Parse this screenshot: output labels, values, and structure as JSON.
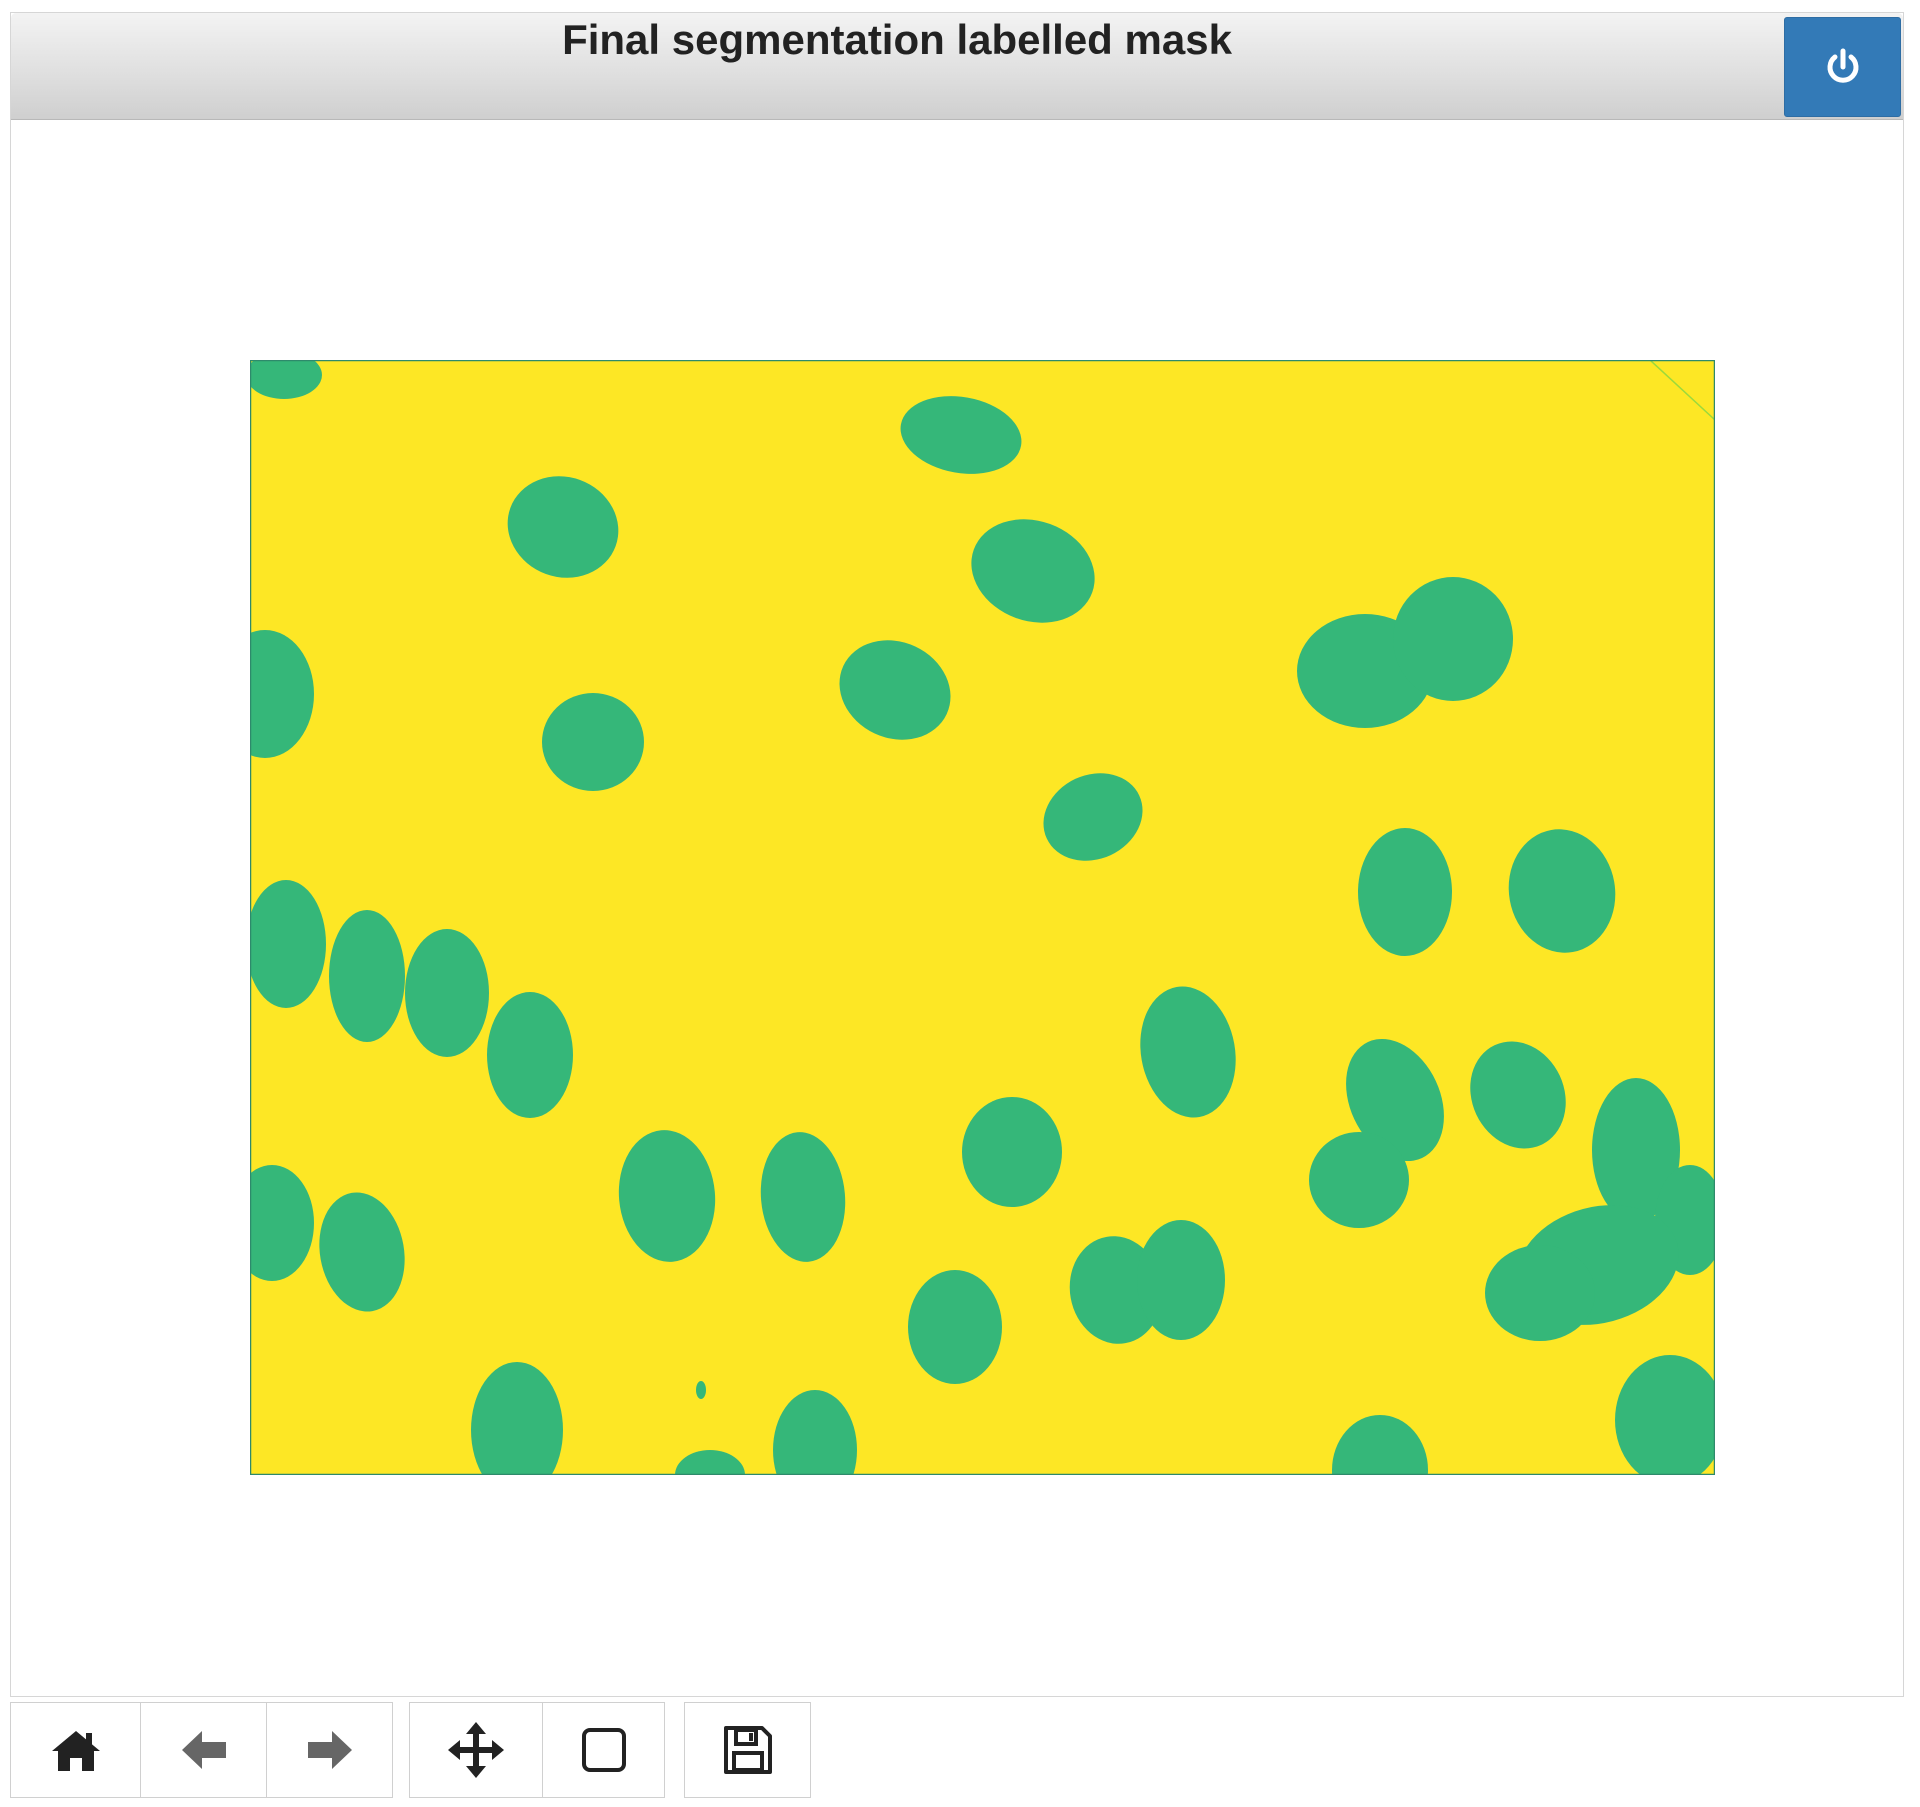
{
  "window": {
    "title": "Final segmentation labelled mask"
  },
  "image": {
    "background_color": "#FDE725",
    "object_color": "#35B779",
    "border_color": "#2E8A6B"
  },
  "toolbar": {
    "buttons": [
      {
        "icon": "home-icon"
      },
      {
        "icon": "arrow-left-icon"
      },
      {
        "icon": "arrow-right-icon"
      },
      {
        "icon": "move-icon"
      },
      {
        "icon": "zoom-rect-icon"
      },
      {
        "icon": "save-icon"
      }
    ]
  },
  "colors": {
    "accent": "#337ab7",
    "titlebar": "#dedede"
  }
}
